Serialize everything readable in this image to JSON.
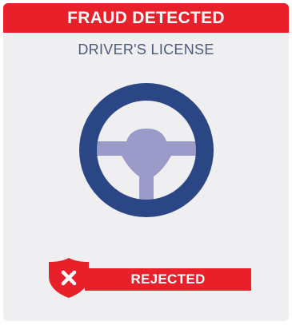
{
  "banner": {
    "title": "FRAUD DETECTED"
  },
  "document": {
    "type_label": "DRIVER'S LICENSE",
    "icon": "steering-wheel-icon"
  },
  "status": {
    "label": "REJECTED",
    "icon": "shield-x-icon"
  },
  "colors": {
    "alert_red": "#e8202a",
    "card_bg": "#efeff2",
    "navy": "#2a4684",
    "lavender": "#9a9bc8",
    "subtitle_text": "#4c5a79"
  }
}
